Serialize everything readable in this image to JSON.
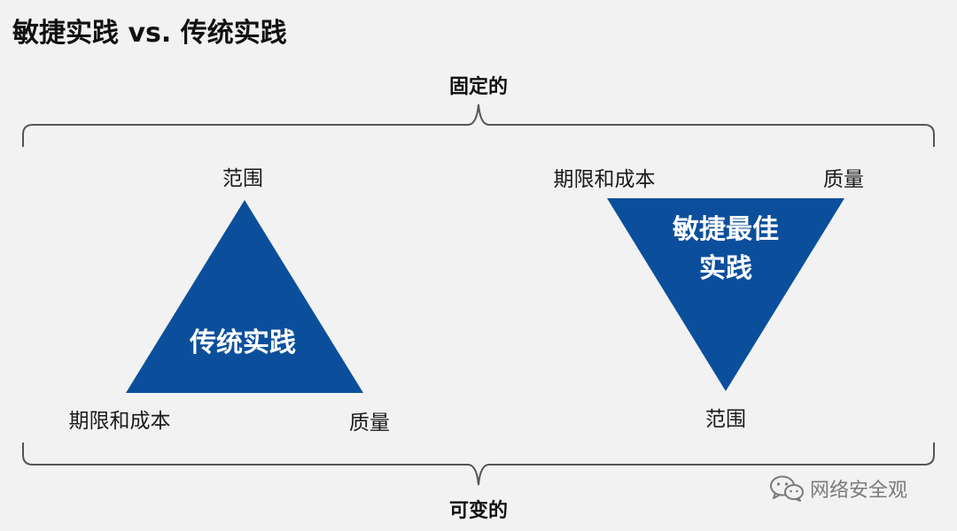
{
  "title": "敏捷实践 vs. 传统实践",
  "top_brace_label": "固定的",
  "bottom_brace_label": "可变的",
  "traditional": {
    "center_label": "传统实践",
    "top": "范围",
    "bottom_left": "期限和成本",
    "bottom_right": "质量"
  },
  "agile": {
    "center_line1": "敏捷最佳",
    "center_line2": "实践",
    "top_left": "期限和成本",
    "top_right": "质量",
    "bottom": "范围"
  },
  "colors": {
    "triangle": "#0b4f9c",
    "brace": "#555555",
    "background": "#f2f2f2"
  },
  "watermark": {
    "text": "网络安全观",
    "icon": "wechat-icon"
  }
}
